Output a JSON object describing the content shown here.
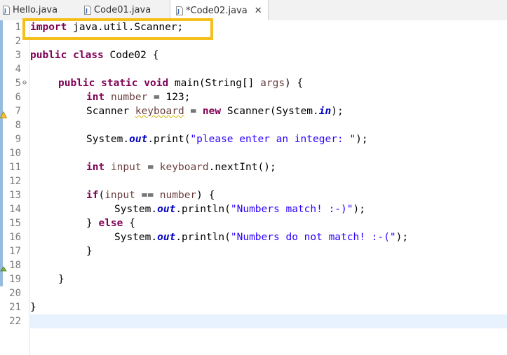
{
  "tabs": [
    {
      "label": "Hello.java",
      "icon": "java-file-icon",
      "active": false
    },
    {
      "label": "Code01.java",
      "icon": "java-file-icon",
      "active": false
    },
    {
      "label": "*Code02.java",
      "icon": "java-file-icon",
      "active": true,
      "close": "✕"
    }
  ],
  "line_numbers": [
    "1",
    "2",
    "3",
    "4",
    "5",
    "6",
    "7",
    "8",
    "9",
    "10",
    "11",
    "12",
    "13",
    "14",
    "15",
    "16",
    "17",
    "18",
    "19",
    "20",
    "21",
    "22"
  ],
  "fold_marker": "⊖",
  "code": {
    "l1": {
      "kw": "import",
      "rest": " java.util.Scanner;"
    },
    "l3": {
      "kw1": "public",
      "kw2": "class",
      "rest": " Code02 {"
    },
    "l5": {
      "kw1": "public",
      "kw2": "static",
      "kw3": "void",
      "name": " main(String[] ",
      "param": "args",
      "end": ") {"
    },
    "l6": {
      "kw": "int",
      "var": "number",
      "rest": " = 123;"
    },
    "l7": {
      "type": "Scanner ",
      "var": "keyboard",
      "eq": " = ",
      "kw": "new",
      "call": " Scanner(System.",
      "field": "in",
      "end": ");"
    },
    "l9": {
      "pre": "System.",
      "field": "out",
      "mid": ".print(",
      "str": "\"please enter an integer: \"",
      "end": ");"
    },
    "l11": {
      "kw": "int",
      "var": "input",
      "eq": " = ",
      "var2": "keyboard",
      "rest": ".nextInt();"
    },
    "l13": {
      "kw": "if",
      "open": "(",
      "var1": "input",
      "op": " == ",
      "var2": "number",
      "end": ") {"
    },
    "l14": {
      "pre": "System.",
      "field": "out",
      "mid": ".println(",
      "str": "\"Numbers match! :-)\"",
      "end": ");"
    },
    "l15": {
      "pre": "} ",
      "kw": "else",
      "end": " {"
    },
    "l16": {
      "pre": "System.",
      "field": "out",
      "mid": ".println(",
      "str": "\"Numbers do not match! :-(\"",
      "end": ");"
    },
    "l17": {
      "text": "}"
    },
    "l19": {
      "text": "}"
    },
    "l21": {
      "text": "}"
    }
  },
  "colors": {
    "keyword": "#7f0055",
    "string": "#2a00ff",
    "field": "#0000c0",
    "local_variable": "#6a3e3e",
    "highlight_box": "#f5c01e",
    "current_line": "#e8f2fe"
  }
}
